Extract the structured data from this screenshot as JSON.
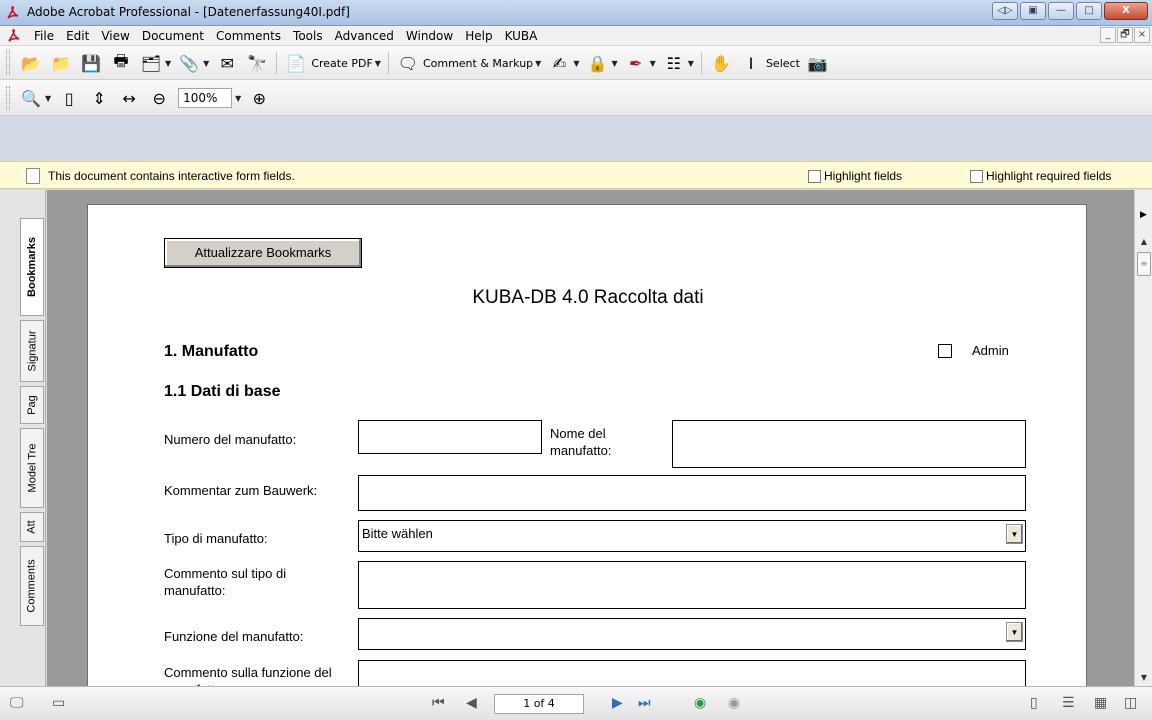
{
  "window": {
    "title": "Adobe Acrobat Professional - [Datenerfassung40I.pdf]",
    "controls": {
      "extra": "◁▷",
      "extra2": "▣",
      "minimize": "—",
      "maximize": "□",
      "close": "X"
    }
  },
  "menu": {
    "items": [
      "File",
      "Edit",
      "View",
      "Document",
      "Comments",
      "Tools",
      "Advanced",
      "Window",
      "Help",
      "KUBA"
    ],
    "doc_controls": {
      "minimize": "_",
      "restore": "🗗",
      "close": "×"
    }
  },
  "toolbar": {
    "create_pdf": "Create PDF",
    "comment_markup": "Comment & Markup",
    "select": "Select",
    "zoom_value": "100%"
  },
  "infobar": {
    "message": "This document contains interactive form fields.",
    "highlight_fields": "Highlight fields",
    "highlight_required": "Highlight required fields"
  },
  "nav_tabs": [
    "Bookmarks",
    "Signatur",
    "Pag",
    "Model Tre",
    "Att",
    "Comments"
  ],
  "form": {
    "bookmark_button": "Attualizzare Bookmarks",
    "doc_title": "KUBA-DB 4.0 Raccolta dati",
    "section1": "1. Manufatto",
    "admin_label": "Admin",
    "section1_1": "1.1 Dati di base",
    "labels": {
      "numero": "Numero del manufatto:",
      "nome": "Nome del manufatto:",
      "kommentar": "Kommentar zum Bauwerk:",
      "tipo": "Tipo di manufatto:",
      "commento_tipo": "Commento sul tipo di manufatto:",
      "funzione": "Funzione del manufatto:",
      "commento_funzione": "Commento sulla funzione del manufatto:"
    },
    "tipo_value": "Bitte wählen",
    "funzione_value": ""
  },
  "status": {
    "page_indicator": "1 of 4"
  },
  "colors": {
    "infobar": "#fffbd6",
    "doc_bg": "#9a9a9a",
    "title_bar": "#b9d1ec"
  },
  "icons": [
    "acrobat-icon",
    "open-icon",
    "save-icon",
    "print-icon",
    "attach-icon",
    "email-icon",
    "find-icon",
    "hand-icon",
    "snapshot-icon",
    "zoom-in-icon",
    "zoom-out-icon"
  ]
}
